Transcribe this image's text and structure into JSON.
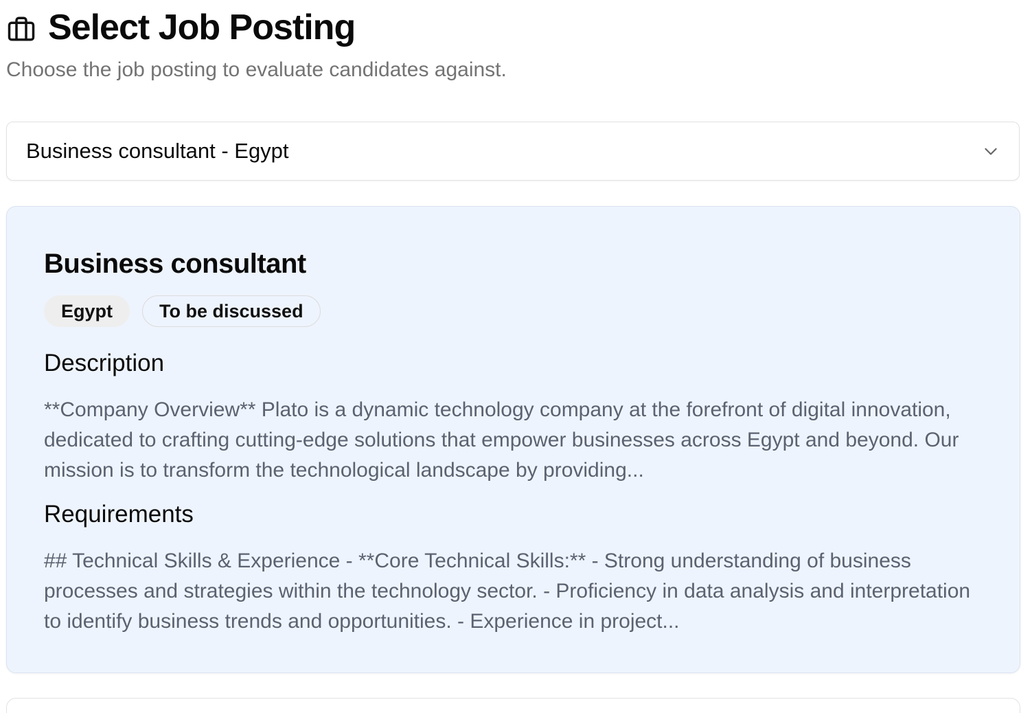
{
  "header": {
    "icon": "briefcase-icon",
    "title": "Select Job Posting",
    "subtitle": "Choose the job posting to evaluate candidates against."
  },
  "job_select": {
    "selected_value": "Business consultant - Egypt",
    "icon": "chevron-down-icon"
  },
  "job_card": {
    "title": "Business consultant",
    "badges": {
      "location": "Egypt",
      "salary": "To be discussed"
    },
    "description": {
      "heading": "Description",
      "text": "**Company Overview** Plato is a dynamic technology company at the forefront of digital innovation, dedicated to crafting cutting-edge solutions that empower businesses across Egypt and beyond. Our mission is to transform the technological landscape by providing..."
    },
    "requirements": {
      "heading": "Requirements",
      "text": "## Technical Skills & Experience - **Core Technical Skills:** - Strong understanding of business processes and strategies within the technology sector. - Proficiency in data analysis and interpretation to identify business trends and opportunities. - Experience in project..."
    }
  },
  "colors": {
    "card_background": "#eef4fd",
    "muted_text": "#5b6270",
    "subtitle_text": "#737373"
  }
}
